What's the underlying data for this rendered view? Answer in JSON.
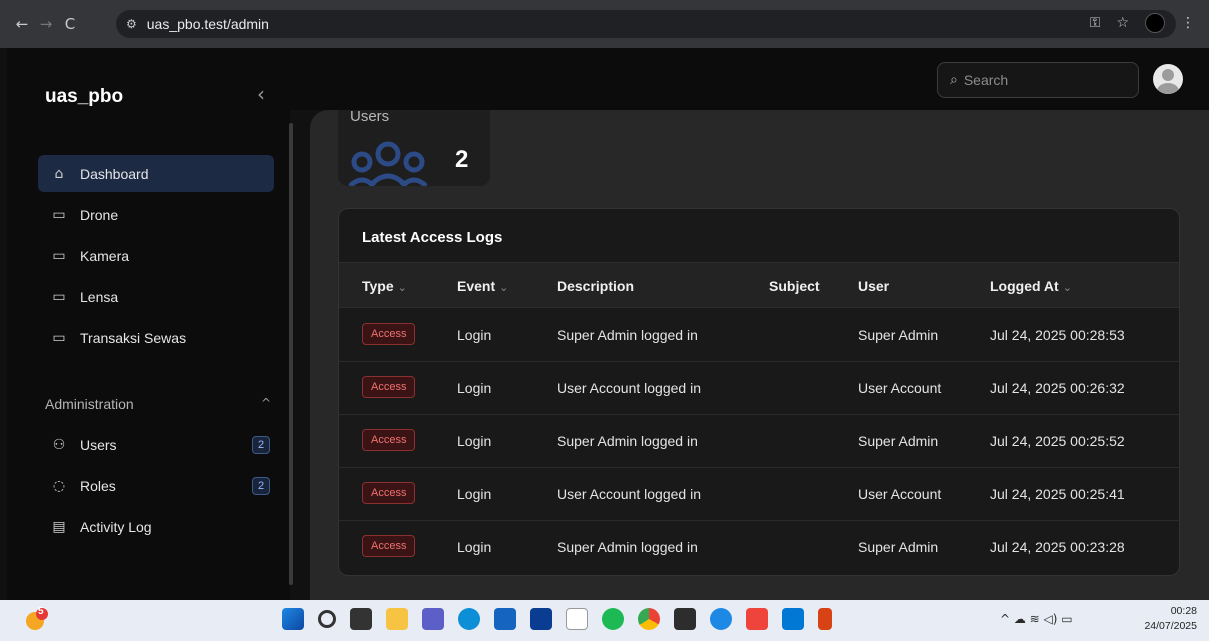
{
  "browser": {
    "url": "uas_pbo.test/admin",
    "back_icon": "←",
    "forward_icon": "→",
    "reload_icon": "C",
    "site_settings_icon": "⚙",
    "key_icon": "⚿",
    "star_icon": "☆",
    "menu_icon": "⋮"
  },
  "sidebar": {
    "brand": "uas_pbo",
    "collapse_icon": "‹",
    "items": [
      {
        "label": "Dashboard",
        "icon": "⌂",
        "active": true
      },
      {
        "label": "Drone",
        "icon": "▭"
      },
      {
        "label": "Kamera",
        "icon": "▭"
      },
      {
        "label": "Lensa",
        "icon": "▭"
      },
      {
        "label": "Transaksi Sewas",
        "icon": "▭"
      }
    ],
    "admin_group": {
      "label": "Administration",
      "caret": "^",
      "items": [
        {
          "label": "Users",
          "icon": "⚇",
          "badge": "2"
        },
        {
          "label": "Roles",
          "icon": "◌",
          "badge": "2"
        },
        {
          "label": "Activity Log",
          "icon": "▤"
        }
      ]
    }
  },
  "topbar": {
    "search_placeholder": "Search",
    "search_icon": "⌕"
  },
  "stats": {
    "users_label": "Users",
    "users_value": "2"
  },
  "logs": {
    "title": "Latest Access Logs",
    "columns": [
      {
        "label": "Type",
        "sortable": true
      },
      {
        "label": "Event",
        "sortable": true
      },
      {
        "label": "Description",
        "sortable": false
      },
      {
        "label": "Subject",
        "sortable": false
      },
      {
        "label": "User",
        "sortable": false
      },
      {
        "label": "Logged At",
        "sortable": true
      }
    ],
    "sort_icon": "⌄",
    "rows": [
      {
        "type": "Access",
        "event": "Login",
        "description": "Super Admin logged in",
        "subject": "",
        "user": "Super Admin",
        "logged_at": "Jul 24, 2025 00:28:53"
      },
      {
        "type": "Access",
        "event": "Login",
        "description": "User Account logged in",
        "subject": "",
        "user": "User Account",
        "logged_at": "Jul 24, 2025 00:26:32"
      },
      {
        "type": "Access",
        "event": "Login",
        "description": "Super Admin logged in",
        "subject": "",
        "user": "Super Admin",
        "logged_at": "Jul 24, 2025 00:25:52"
      },
      {
        "type": "Access",
        "event": "Login",
        "description": "User Account logged in",
        "subject": "",
        "user": "User Account",
        "logged_at": "Jul 24, 2025 00:25:41"
      },
      {
        "type": "Access",
        "event": "Login",
        "description": "Super Admin logged in",
        "subject": "",
        "user": "Super Admin",
        "logged_at": "Jul 24, 2025 00:23:28"
      }
    ]
  },
  "taskbar": {
    "weather_badge": "5",
    "time": "00:28",
    "date": "24/07/2025",
    "tray_icons": "^  ☁  ≋  ◁)  ▭"
  },
  "colors": {
    "accent": "#1c2a44",
    "badge_border": "#3d5a8a",
    "access_pill": "#f07070"
  }
}
